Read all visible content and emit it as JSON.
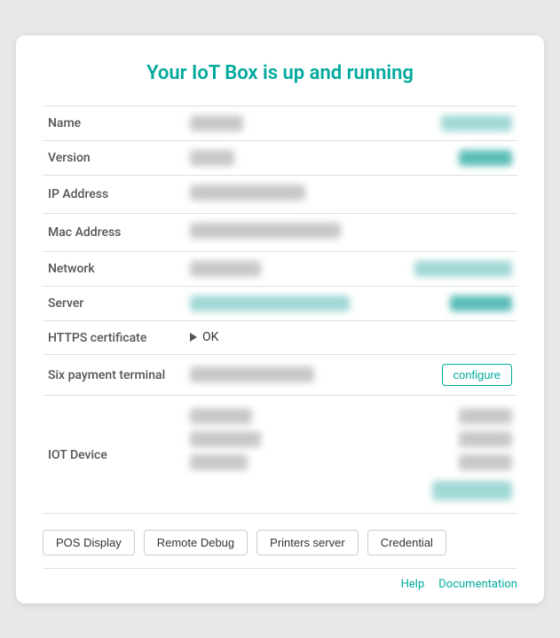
{
  "page": {
    "title": "Your IoT Box is up and running"
  },
  "fields": {
    "name": {
      "label": "Name"
    },
    "version": {
      "label": "Version"
    },
    "ip_address": {
      "label": "IP Address"
    },
    "mac_address": {
      "label": "Mac Address"
    },
    "network": {
      "label": "Network"
    },
    "server": {
      "label": "Server"
    },
    "https_certificate": {
      "label": "HTTPS certificate",
      "value": "OK"
    },
    "six_payment": {
      "label": "Six payment terminal"
    },
    "iot_device": {
      "label": "IOT Device"
    }
  },
  "buttons": {
    "configure": "configure",
    "pos_display": "POS Display",
    "remote_debug": "Remote Debug",
    "printers_server": "Printers server",
    "credential": "Credential"
  },
  "footer": {
    "help": "Help",
    "documentation": "Documentation"
  }
}
